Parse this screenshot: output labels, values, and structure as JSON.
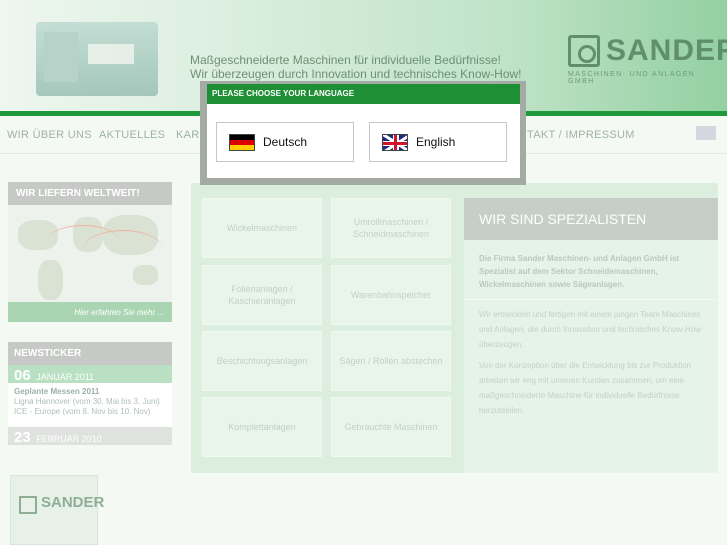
{
  "header": {
    "tagline_line1": "Maßgeschneiderte Maschinen für individuelle Bedürfnisse!",
    "tagline_line2": "Wir überzeugen durch Innovation und technisches Know-How!",
    "logo_name": "SANDER",
    "logo_sub": "MASCHINEN- UND ANLAGEN GMBH"
  },
  "nav": {
    "items": [
      "WIR ÜBER UNS",
      "AKTUELLES",
      "KARR",
      "TAKT / IMPRESSUM"
    ]
  },
  "left": {
    "worldwide_title": "WIR LIEFERN WELTWEIT!",
    "worldwide_link": "Hier erfahren Sie mehr ...",
    "news_title": "NEWSTICKER",
    "news": [
      {
        "day": "06",
        "month": "JANUAR 2011",
        "title": "Geplante Messen 2011",
        "text1": "Ligna Hannover (vom 30. Mai bis 3. Juni)",
        "text2": "ICE - Europe (vom 8. Nov bis 10. Nov)"
      },
      {
        "day": "23",
        "month": "FEBRUAR 2010"
      }
    ],
    "bottom_logo": "SANDER"
  },
  "tiles": [
    "Wickelmaschinen",
    "Umrollmaschinen / Schneidmaschinen",
    "Folienanlagen / Kaschieranlagen",
    "Warenbahnspeicher",
    "Beschichtungsanlagen",
    "Sägen / Rollen abstechen",
    "Komplettanlagen",
    "Gebrauchte Maschinen"
  ],
  "spec": {
    "title": "WIR SIND SPEZIALISTEN",
    "lead": "Die Firma Sander Maschinen- und Anlagen GmbH ist Spezialist auf dem Sektor Schneidemaschinen, Wickelmaschinen sowie Sägeanlagen.",
    "p1": "Wir entwickeln und fertigen mit einem jungen Team Maschinen und Anlagen, die durch Innovation und technisches Know-How überzeugen.",
    "p2": "Von der Konzeption über die Entwicklung bis zur Produktion arbeiten wir eng mit unseren Kunden zusammen, um eine maßgeschneiderte Maschine für individuelle Bedürfnisse herzustellen."
  },
  "dialog": {
    "title": "PLEASE CHOOSE YOUR LANGUAGE",
    "deutsch": "Deutsch",
    "english": "English"
  },
  "colors": {
    "accent": "#1e8f35",
    "dialog_bg": "#ffffff",
    "overlay": "#a3aba4"
  }
}
